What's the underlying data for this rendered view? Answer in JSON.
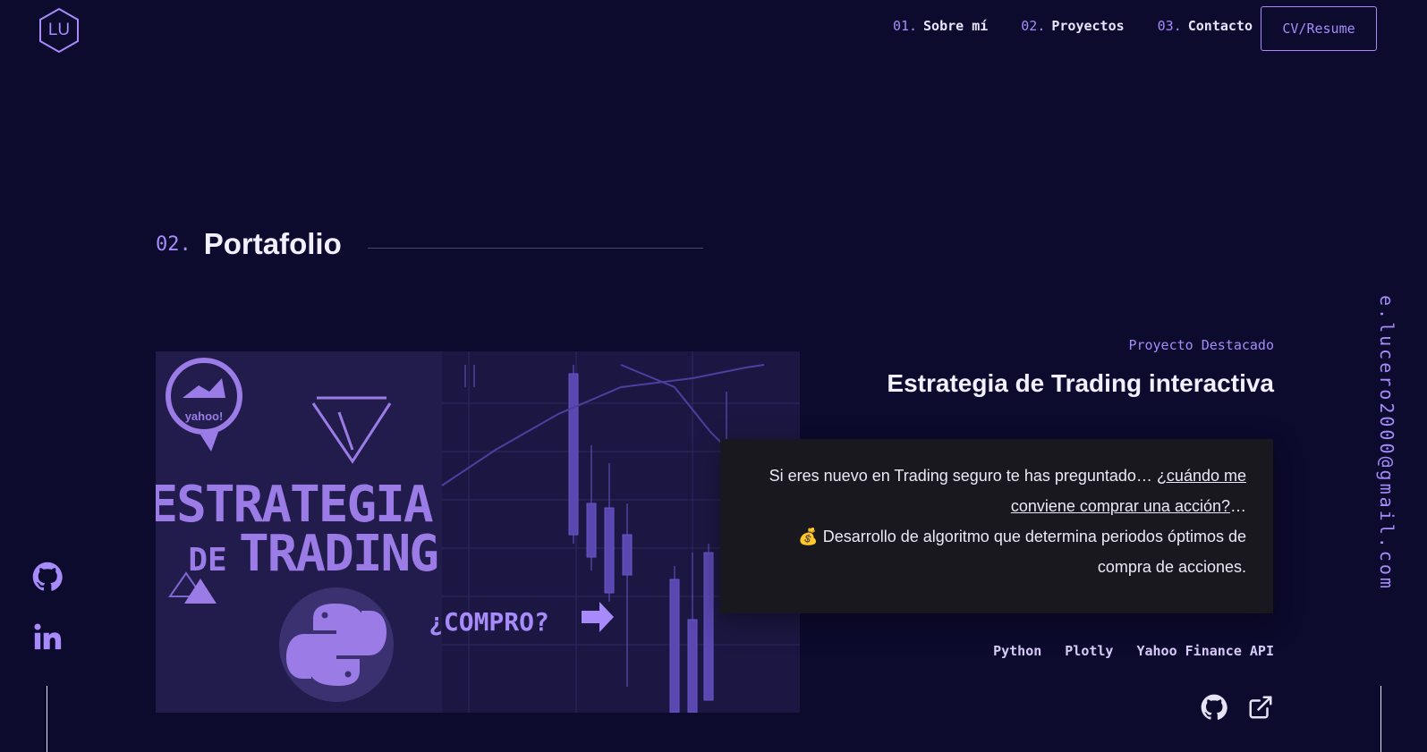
{
  "logo": {
    "text": "LU",
    "icon": "hexagon-logo-icon"
  },
  "nav": {
    "items": [
      {
        "num": "01.",
        "label": "Sobre mí"
      },
      {
        "num": "02.",
        "label": "Proyectos"
      },
      {
        "num": "03.",
        "label": "Contacto"
      }
    ],
    "resume_label": "CV/Resume"
  },
  "section": {
    "num": "02.",
    "title": "Portafolio"
  },
  "project": {
    "overline": "Proyecto Destacado",
    "title": "Estrategia de Trading interactiva",
    "image": {
      "badge_text": "yahoo!",
      "line1": "ESTRATEGIA",
      "line2_prefix": "DE",
      "line2": "TRADING",
      "callout": "¿COMPRO?"
    },
    "description": {
      "intro": "Si eres nuevo en Trading seguro te has preguntado… ",
      "link": "¿cuándo me conviene comprar una acción?",
      "ellipsis": "…",
      "emoji": "💰",
      "detail": " Desarrollo de algoritmo que determina periodos óptimos de compra de acciones."
    },
    "tech": [
      "Python",
      "Plotly",
      "Yahoo Finance API"
    ],
    "links": {
      "github": "github-icon",
      "external": "external-link-icon"
    }
  },
  "social": {
    "github": "github-icon",
    "linkedin": "linkedin-icon"
  },
  "email": "e.lucero2000@gmail.com",
  "colors": {
    "background": "#0c0a2d",
    "accent": "#a78bfa",
    "card": "#1a181f"
  }
}
